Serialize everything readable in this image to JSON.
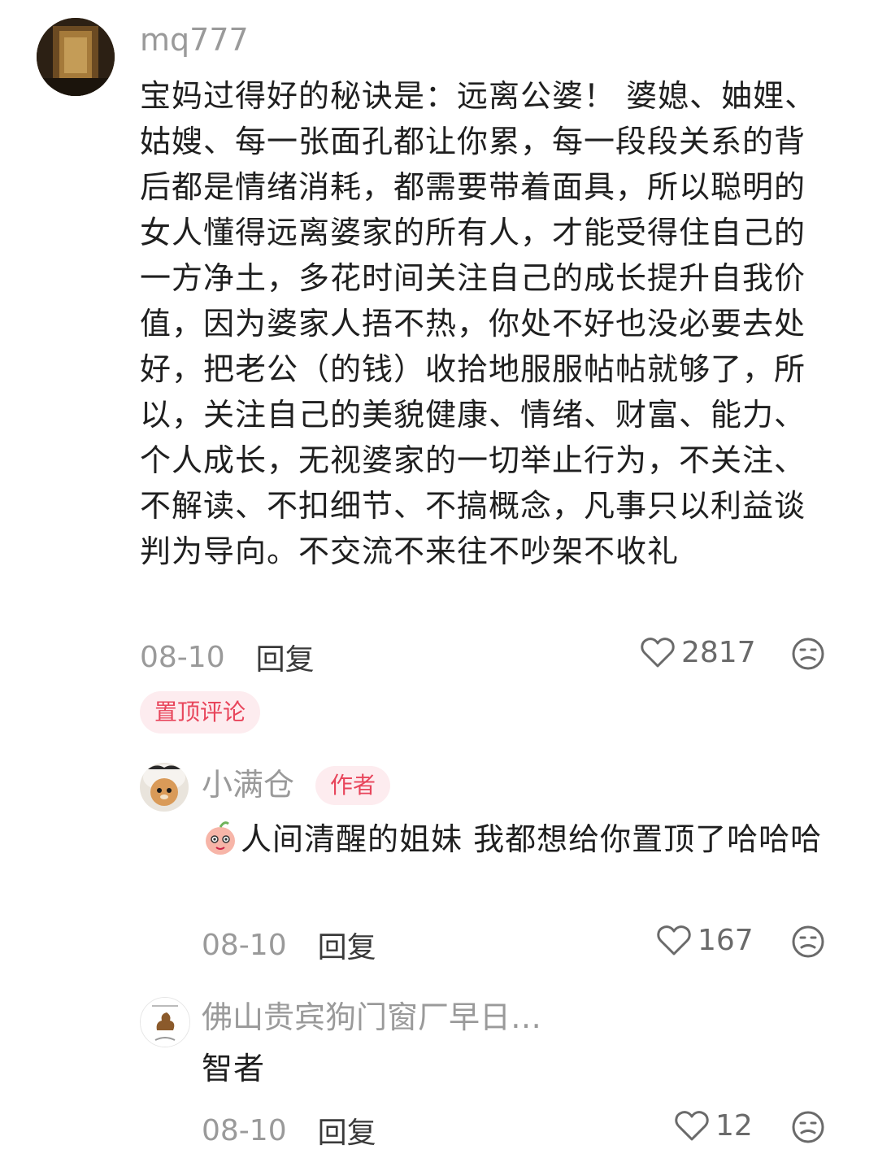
{
  "comment1": {
    "username": "mq777",
    "text": "宝妈过得好的秘诀是：远离公婆！ 婆媳、妯娌、姑嫂、每一张面孔都让你累，每一段段关系的背后都是情绪消耗，都需要带着面具，所以聪明的女人懂得远离婆家的所有人，才能受得住自己的一方净土，多花时间关注自己的成长提升自我价值，因为婆家人捂不热，你处不好也没必要去处好，把老公（的钱）收拾地服服帖帖就够了，所以，关注自己的美貌健康、情绪、财富、能力、个人成长，无视婆家的一切举止行为，不关注、不解读、不扣细节、不搞概念，凡事只以利益谈判为导向。不交流不来往不吵架不收礼",
    "date": "08-10",
    "reply_label": "回复",
    "likes": "2817",
    "pin_label": "置顶评论"
  },
  "reply1": {
    "username": "小满仓",
    "author_label": "作者",
    "text": "人间清醒的姐妹 我都想给你置顶了哈哈哈",
    "date": "08-10",
    "reply_label": "回复",
    "likes": "167"
  },
  "reply2": {
    "username": "佛山贵宾狗门窗厂早日…",
    "text": "智者",
    "date": "08-10",
    "reply_label": "回复",
    "likes": "12"
  },
  "colors": {
    "accent": "#e8455b",
    "badge_bg": "#fdecef",
    "muted": "#9a9a9a"
  },
  "icons": [
    "heart-icon",
    "dislike-face-icon",
    "emoji-icon"
  ]
}
